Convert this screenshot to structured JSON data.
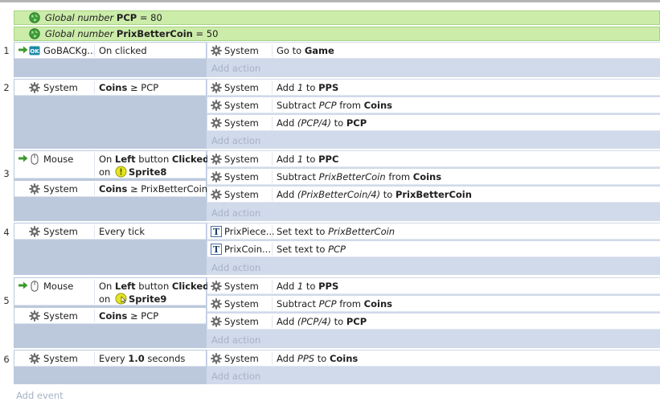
{
  "globals": [
    {
      "prefix": "Global number",
      "name": "PCP",
      "eq": " = 80"
    },
    {
      "prefix": "Global number",
      "name": "PrixBetterCoin",
      "eq": " = 50"
    }
  ],
  "add_action_label": "Add action",
  "add_event_label": "Add event",
  "events": [
    {
      "number": "1",
      "conditions": [
        {
          "object": "GoBACKg...",
          "text": "On clicked"
        }
      ],
      "actions": [
        {
          "object": "System",
          "a": "Go to ",
          "b": "Game"
        }
      ]
    },
    {
      "number": "2",
      "conditions": [
        {
          "object": "System",
          "bold": "Coins",
          "rest": " ≥ PCP"
        }
      ],
      "actions": [
        {
          "object": "System",
          "a": "Add ",
          "i": "1",
          "c": " to ",
          "b": "PPS"
        },
        {
          "object": "System",
          "a": "Subtract ",
          "i": "PCP",
          "c": " from ",
          "b": "Coins"
        },
        {
          "object": "System",
          "a": "Add ",
          "i": "(PCP/4)",
          "c": "  to ",
          "b": "PCP"
        }
      ]
    },
    {
      "number": "3",
      "conditions": [
        {
          "object": "Mouse",
          "l1a": "On ",
          "l1b": "Left",
          "l1c": " button ",
          "l1d": "Clicked",
          "l2a": "on ",
          "l2b": "Sprite8"
        },
        {
          "object": "System",
          "bold": "Coins",
          "rest": " ≥ PrixBetterCoin"
        }
      ],
      "actions": [
        {
          "object": "System",
          "a": "Add ",
          "i": "1",
          "c": " to ",
          "b": "PPC"
        },
        {
          "object": "System",
          "a": "Subtract ",
          "i": "PrixBetterCoin",
          "c": " from ",
          "b": "Coins"
        },
        {
          "object": "System",
          "a": "Add ",
          "i": "(PrixBetterCoin/4)",
          "c": "  to ",
          "b": "PrixBetterCoin"
        }
      ]
    },
    {
      "number": "4",
      "conditions": [
        {
          "object": "System",
          "text": "Every tick"
        }
      ],
      "actions": [
        {
          "object": "PrixPiece...",
          "a": "Set text to ",
          "i": "PrixBetterCoin"
        },
        {
          "object": "PrixCoin...",
          "a": "Set text to ",
          "i": "PCP"
        }
      ]
    },
    {
      "number": "5",
      "conditions": [
        {
          "object": "Mouse",
          "l1a": "On ",
          "l1b": "Left",
          "l1c": " button ",
          "l1d": "Clicked",
          "l2a": "on ",
          "l2b": "Sprite9"
        },
        {
          "object": "System",
          "bold": "Coins",
          "rest": " ≥ PCP"
        }
      ],
      "actions": [
        {
          "object": "System",
          "a": "Add ",
          "i": "1",
          "c": " to ",
          "b": "PPS"
        },
        {
          "object": "System",
          "a": "Subtract ",
          "i": "PCP",
          "c": " from ",
          "b": "Coins"
        },
        {
          "object": "System",
          "a": "Add ",
          "i": "(PCP/4)",
          "c": "  to ",
          "b": "PCP"
        }
      ]
    },
    {
      "number": "6",
      "conditions": [
        {
          "object": "System",
          "a": "Every ",
          "bold": "1.0",
          "rest": " seconds"
        }
      ],
      "actions": [
        {
          "object": "System",
          "i": "PPS",
          "c": " to ",
          "b": "Coins",
          "a": "Add "
        }
      ]
    }
  ]
}
